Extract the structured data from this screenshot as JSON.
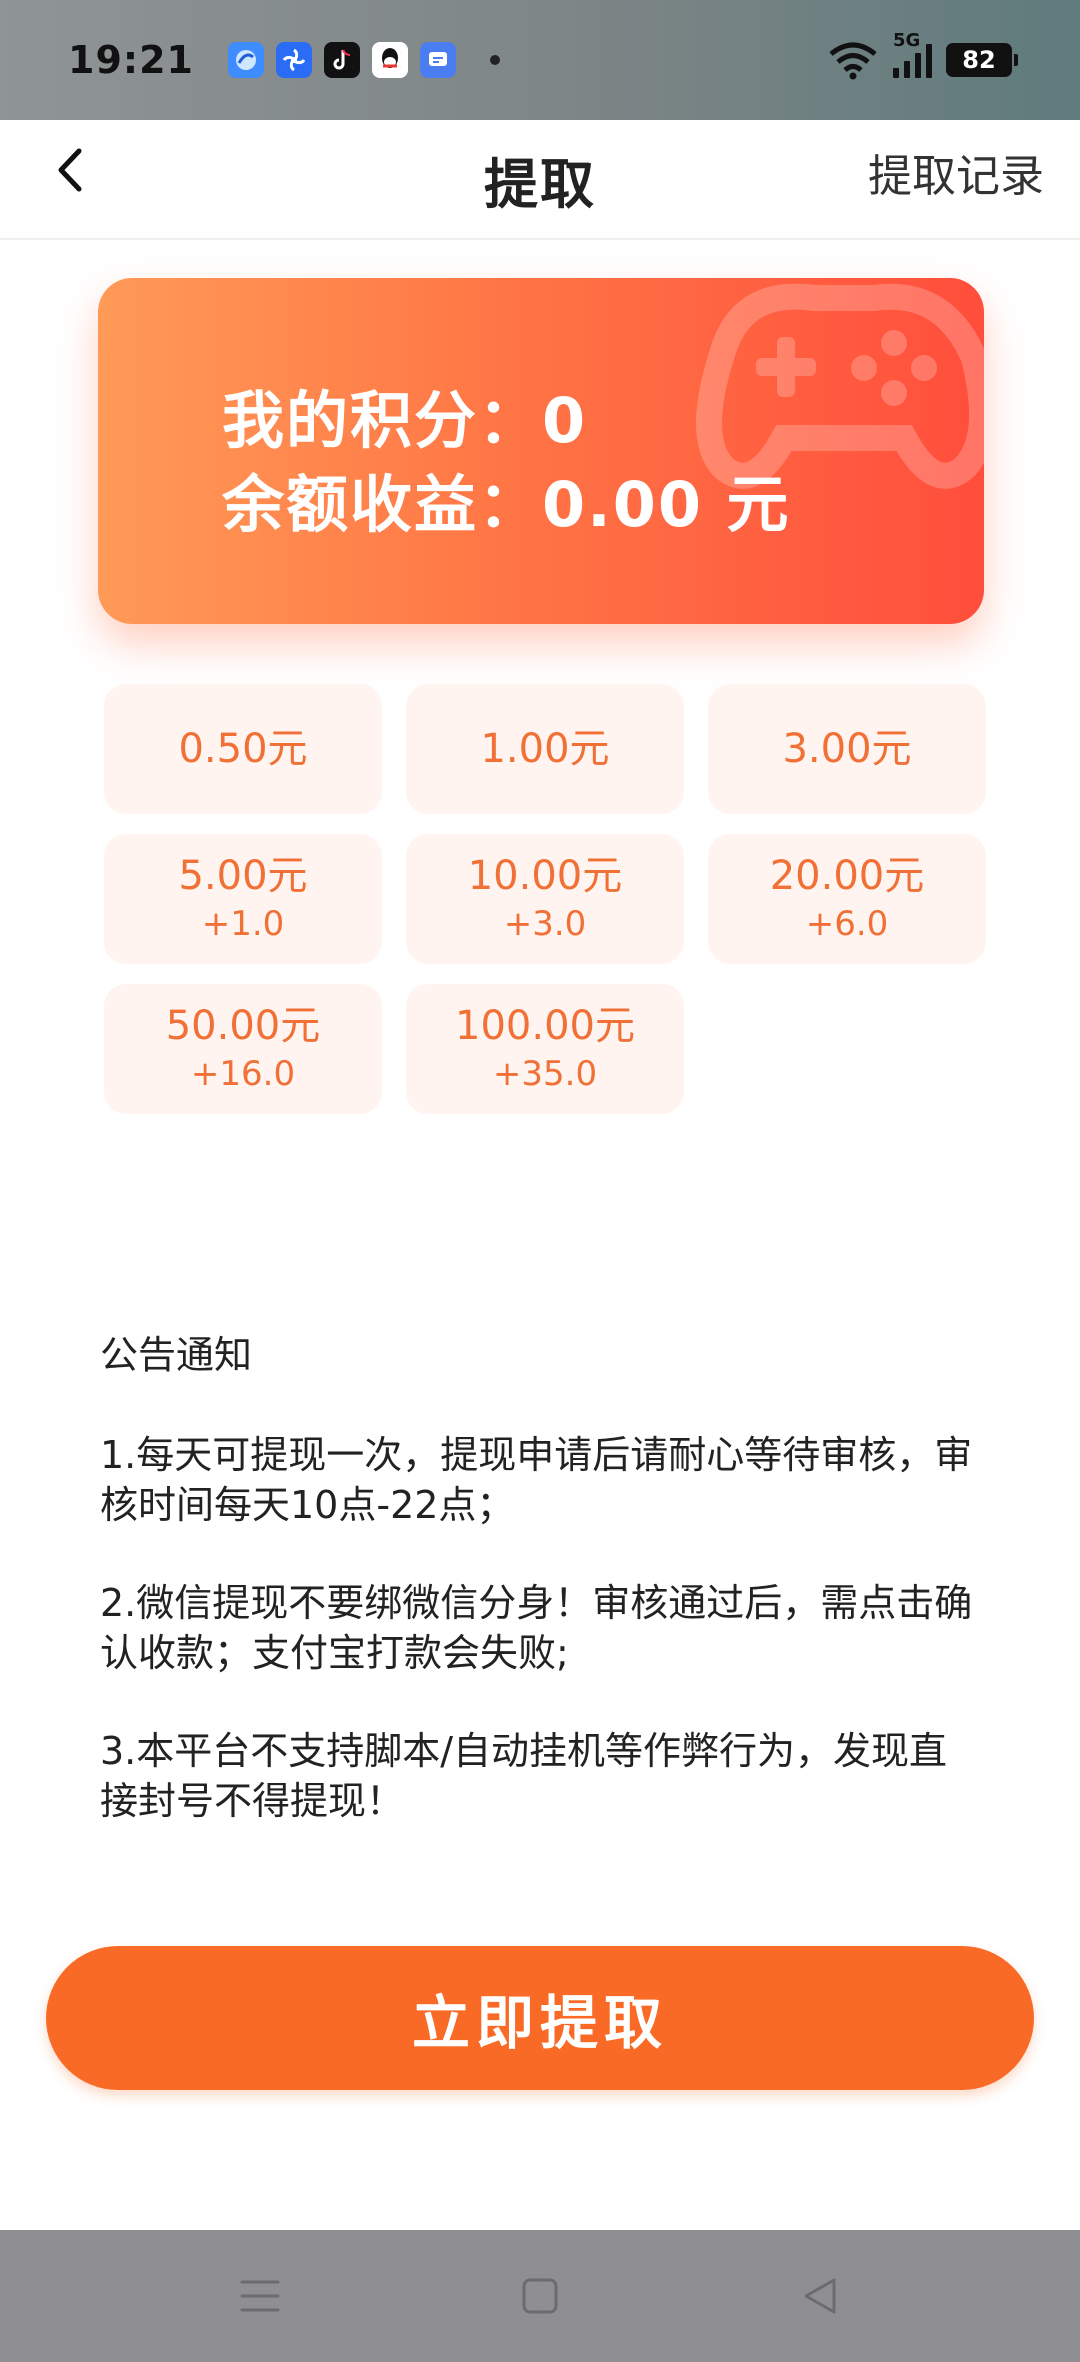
{
  "status_bar": {
    "time": "19:21",
    "network": "5G",
    "battery": "82",
    "notification_icons": [
      "browser-icon",
      "pinwheel-icon",
      "tiktok-icon",
      "qq-icon",
      "message-icon"
    ]
  },
  "header": {
    "title": "提取",
    "record_link": "提取记录"
  },
  "balance": {
    "points_line": "我的积分：0",
    "earnings_line": "余额收益：0.00 元"
  },
  "amounts": [
    {
      "value": "0.50元",
      "bonus": ""
    },
    {
      "value": "1.00元",
      "bonus": ""
    },
    {
      "value": "3.00元",
      "bonus": ""
    },
    {
      "value": "5.00元",
      "bonus": "+1.0"
    },
    {
      "value": "10.00元",
      "bonus": "+3.0"
    },
    {
      "value": "20.00元",
      "bonus": "+6.0"
    },
    {
      "value": "50.00元",
      "bonus": "+16.0"
    },
    {
      "value": "100.00元",
      "bonus": "+35.0"
    }
  ],
  "notice": {
    "title": "公告通知",
    "items": [
      "1.每天可提现一次，提现申请后请耐心等待审核，审核时间每天10点-22点；",
      "2.微信提现不要绑微信分身！审核通过后，需点击确认收款；支付宝打款会失败;",
      "3.本平台不支持脚本/自动挂机等作弊行为，发现直接封号不得提现！"
    ]
  },
  "withdraw_button": "立即提取",
  "colors": {
    "accent": "#f96a26",
    "amount_text": "#f07036",
    "amount_bg": "#fff4f0",
    "card_gradient_start": "#ff9a57",
    "card_gradient_end": "#ff4e3c"
  }
}
